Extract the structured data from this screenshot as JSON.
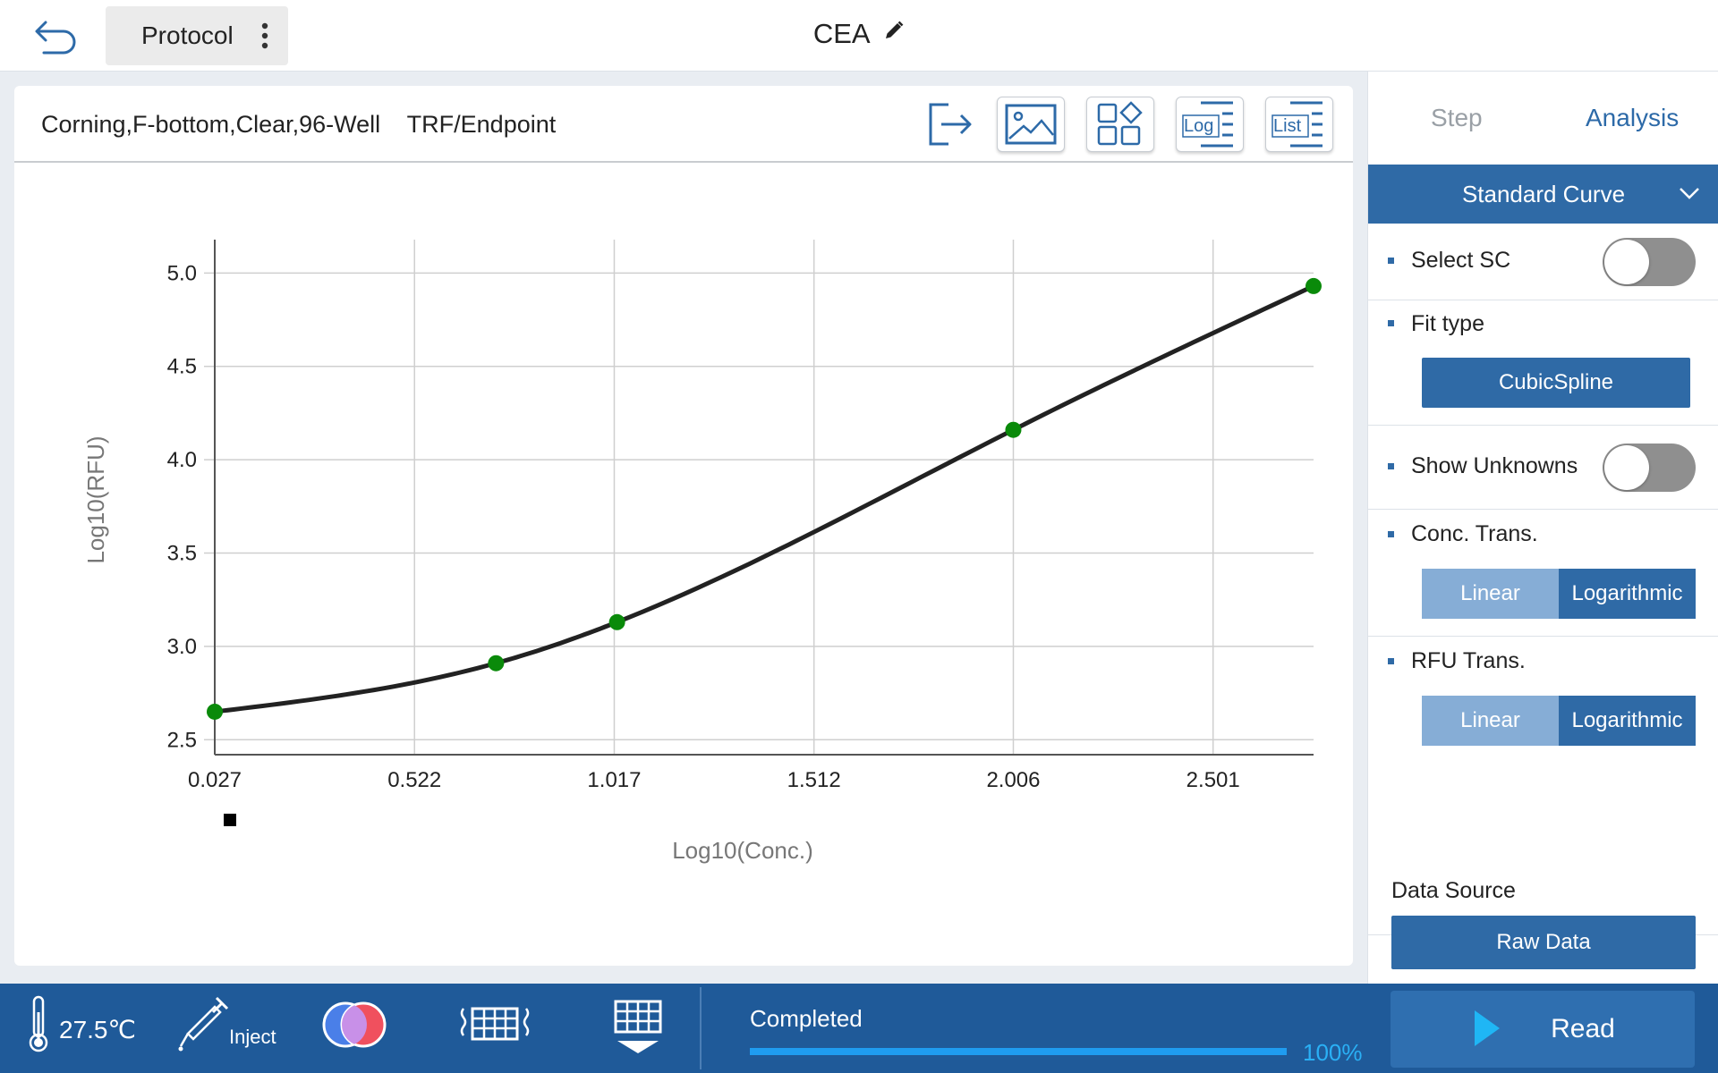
{
  "header": {
    "protocol_label": "Protocol",
    "title": "CEA"
  },
  "plate": {
    "plate_type": "Corning,F-bottom,Clear,96-Well",
    "read_mode": "TRF/Endpoint"
  },
  "toolbar": {
    "log_label": "Log",
    "list_label": "List"
  },
  "chart_data": {
    "type": "line",
    "xlabel": "Log10(Conc.)",
    "ylabel": "Log10(RFU)",
    "x_ticks": [
      "0.027",
      "0.522",
      "1.017",
      "1.512",
      "2.006",
      "2.501"
    ],
    "y_ticks": [
      "2.5",
      "3.0",
      "3.5",
      "4.0",
      "4.5",
      "5.0"
    ],
    "xlim": [
      0.027,
      2.75
    ],
    "ylim": [
      2.42,
      5.15
    ],
    "grid": true,
    "fit": "CubicSpline",
    "points": [
      {
        "x": 0.027,
        "y": 2.65
      },
      {
        "x": 0.724,
        "y": 2.91
      },
      {
        "x": 1.024,
        "y": 3.13
      },
      {
        "x": 2.006,
        "y": 4.16
      },
      {
        "x": 2.75,
        "y": 4.93
      }
    ],
    "point_color": "#0a8a0a",
    "curve_color": "#222222"
  },
  "panel": {
    "tab_step": "Step",
    "tab_analysis": "Analysis",
    "analysis_type": "Standard Curve",
    "select_sc_label": "Select SC",
    "fit_type_label": "Fit type",
    "fit_type_value": "CubicSpline",
    "show_unknowns_label": "Show Unknowns",
    "conc_trans_label": "Conc. Trans.",
    "rfu_trans_label": "RFU Trans.",
    "linear_label": "Linear",
    "logarithmic_label": "Logarithmic",
    "data_source_label": "Data Source",
    "data_source_value": "Raw Data"
  },
  "footer": {
    "temperature": "27.5℃",
    "inject_label": "Inject",
    "status": "Completed",
    "progress": 1.0,
    "progress_label": "100%",
    "read_label": "Read"
  }
}
